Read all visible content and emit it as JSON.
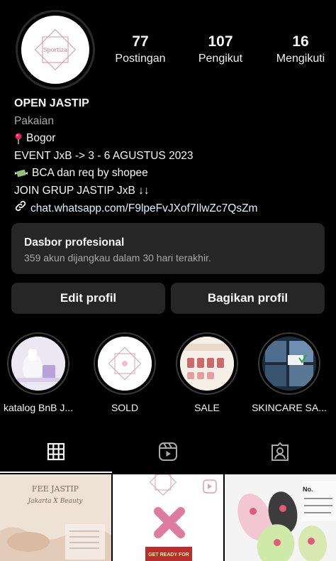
{
  "profile": {
    "logo_text": "Sportiza",
    "stats": [
      {
        "value": "77",
        "label": "Postingan"
      },
      {
        "value": "107",
        "label": "Pengikut"
      },
      {
        "value": "16",
        "label": "Mengikuti"
      }
    ]
  },
  "bio": {
    "name": "OPEN JASTIP",
    "category": "Pakaian",
    "location": "Bogor",
    "event": "EVENT JxB -> 3 - 6 AGUSTUS 2023",
    "payment": "BCA dan req by shopee",
    "join": "JOIN GRUP JASTIP JxB ↓↓",
    "link": "chat.whatsapp.com/F9lpeFvJXof7IlwZc7QsZm"
  },
  "dashboard": {
    "title": "Dasbor profesional",
    "subtitle": "359 akun dijangkau dalam 30 hari terakhir."
  },
  "buttons": {
    "edit": "Edit profil",
    "share": "Bagikan profil"
  },
  "highlights": [
    {
      "label": "katalog BnB J..."
    },
    {
      "label": "SOLD"
    },
    {
      "label": "SALE"
    },
    {
      "label": "SKINCARE SA..."
    }
  ],
  "grid": {
    "post1_title": "FEE JASTIP",
    "post1_subtitle": "Jakarta X Beauty",
    "post2_banner": "GET READY FOR",
    "post3_tag": "No."
  },
  "icons": {
    "grid_tab": "grid-icon",
    "reels_tab": "reels-icon",
    "tagged_tab": "tagged-icon"
  },
  "colors": {
    "background": "#000000",
    "card": "#262626",
    "muted_text": "#a8a8a8"
  }
}
